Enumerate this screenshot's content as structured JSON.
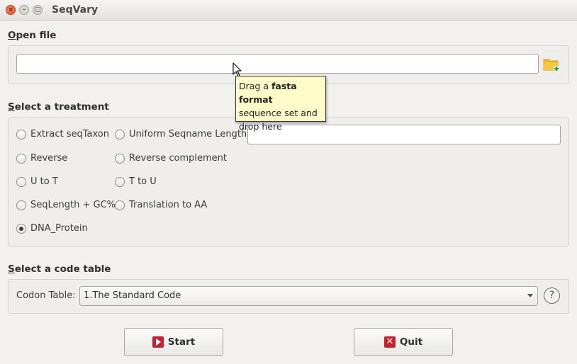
{
  "window": {
    "title": "SeqVary",
    "close_glyph": "×",
    "min_glyph": "–",
    "max_glyph": "□"
  },
  "open_file": {
    "section_prefix": "O",
    "section_rest": "pen file",
    "path_value": "",
    "folder_icon": "folder-add-icon"
  },
  "tooltip": {
    "line1_prefix": "Drag a ",
    "line1_bold": "fasta format",
    "line2": "sequence set and",
    "line3": "drop here"
  },
  "treatment": {
    "section_prefix": "S",
    "section_rest": "elect a treatment",
    "options": [
      {
        "label": "Extract seqTaxon",
        "checked": false
      },
      {
        "label": "Uniform Seqname Length",
        "checked": false
      },
      {
        "label": "Reverse",
        "checked": false
      },
      {
        "label": "Reverse complement",
        "checked": false
      },
      {
        "label": "U to T",
        "checked": false
      },
      {
        "label": "T to U",
        "checked": false
      },
      {
        "label": "SeqLength + GC%",
        "checked": false
      },
      {
        "label": "Translation to AA",
        "checked": false
      },
      {
        "label": "DNA_Protein",
        "checked": true
      }
    ],
    "seqname_length_value": ""
  },
  "code_table": {
    "section_prefix": "S",
    "section_rest": "elect a code table",
    "codon_label": "Codon Table:",
    "selected": "1.The Standard Code",
    "help_glyph": "?"
  },
  "actions": {
    "start_label": "Start",
    "quit_label": "Quit",
    "quit_glyph": "✕"
  }
}
